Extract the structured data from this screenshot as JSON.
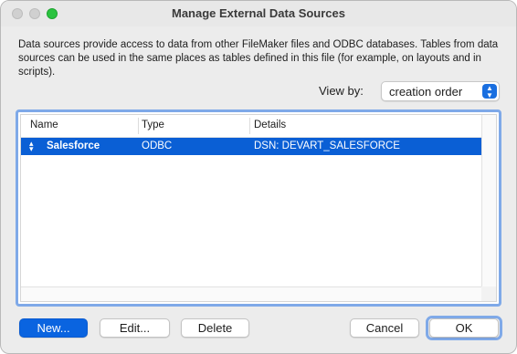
{
  "window": {
    "title": "Manage External Data Sources"
  },
  "description": "Data sources provide access to data from other FileMaker files and ODBC databases. Tables from data sources can be used in the same places as tables defined in this file (for example, on layouts and in scripts).",
  "view_by": {
    "label": "View by:",
    "selected": "creation order"
  },
  "table": {
    "columns": [
      "Name",
      "Type",
      "Details"
    ],
    "rows": [
      {
        "name": "Salesforce",
        "type": "ODBC",
        "details": "DSN: DEVART_SALESFORCE",
        "selected": true
      }
    ]
  },
  "buttons": {
    "new": "New...",
    "edit": "Edit...",
    "delete": "Delete",
    "cancel": "Cancel",
    "ok": "OK"
  },
  "colors": {
    "accent": "#0a64e0",
    "selection": "#0a5fd5",
    "focus_ring": "#7fa9e8",
    "zoom": "#2ac33f"
  }
}
